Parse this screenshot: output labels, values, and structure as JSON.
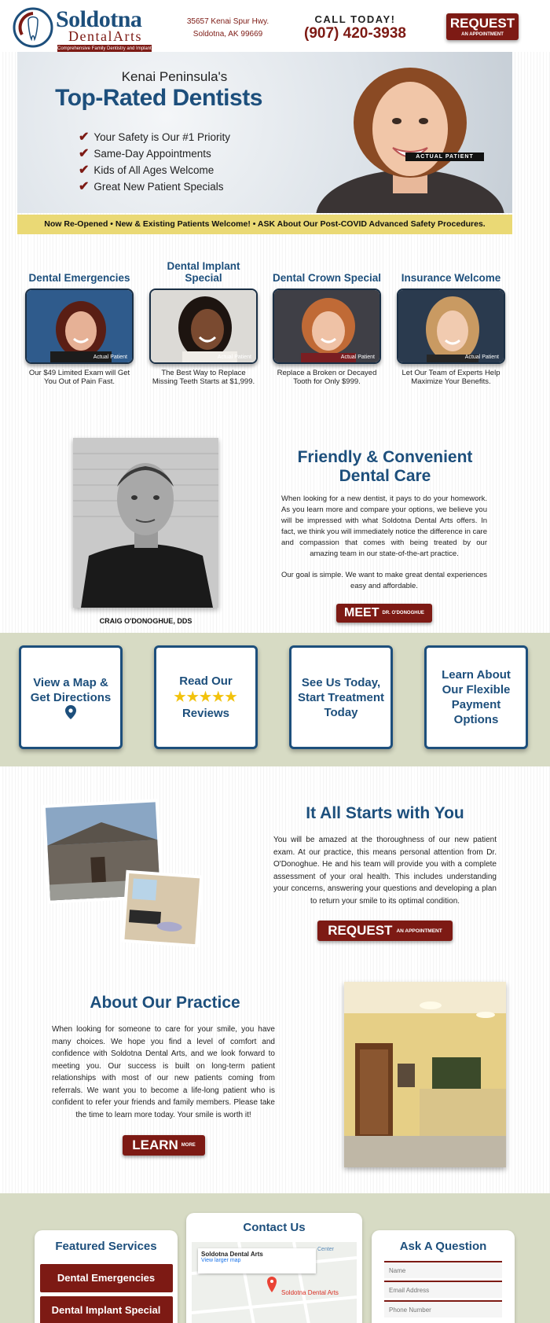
{
  "header": {
    "logo_name": "Soldotna",
    "logo_sub": "DentalArts",
    "logo_tag": "Comprehensive Family Dentistry and Implants",
    "address_line1": "35657 Kenai Spur Hwy.",
    "address_line2": "Soldotna, AK 99669",
    "call_label": "CALL TODAY!",
    "phone": "(907) 420-3938",
    "request_big": "REQUEST",
    "request_small": "AN APPOINTMENT"
  },
  "hero": {
    "subtitle": "Kenai Peninsula's",
    "title": "Top-Rated Dentists",
    "checklist": [
      "Your Safety is Our #1 Priority",
      "Same-Day Appointments",
      "Kids of All Ages Welcome",
      "Great New Patient Specials"
    ],
    "badge": "ACTUAL PATIENT",
    "banner": "Now Re-Opened  •  New & Existing Patients Welcome!  •  ASK About Our Post-COVID Advanced Safety Procedures."
  },
  "specials": [
    {
      "title": "Dental Emergencies",
      "badge": "Actual Patient",
      "desc": "Our $49 Limited Exam will Get You Out of Pain Fast."
    },
    {
      "title": "Dental Implant Special",
      "badge": "Actual Patient",
      "desc": "The Best Way to Replace Missing Teeth Starts at $1,999."
    },
    {
      "title": "Dental Crown Special",
      "badge": "Actual Patient",
      "desc": "Replace a Broken or Decayed Tooth for Only $999."
    },
    {
      "title": "Insurance Welcome",
      "badge": "Actual Patient",
      "desc": "Let Our Team of Experts Help Maximize Your Benefits."
    }
  ],
  "doctor": {
    "name": "CRAIG O'DONOGHUE, DDS",
    "title": "Friendly & Convenient Dental Care",
    "p1": "When looking for a new dentist, it pays to do your homework. As you learn more and compare your options, we believe you will be impressed with what Soldotna Dental Arts offers. In fact, we think you will immediately notice the difference in care and compassion that comes with being treated by our amazing team in our state-of-the-art practice.",
    "p2": "Our goal is simple. We want to make great dental experiences easy and affordable.",
    "meet_big": "MEET",
    "meet_small": "DR. O'DONOGHUE"
  },
  "cta": {
    "map": "View a Map & Get Directions",
    "reviews_top": "Read Our",
    "stars": "★★★★★",
    "reviews_bottom": "Reviews",
    "today": "See Us Today, Start Treatment Today",
    "payment": "Learn About Our Flexible Payment Options"
  },
  "starts": {
    "title": "It All Starts with You",
    "text": "You will be amazed at the thoroughness of our new patient exam. At our practice, this means personal attention from Dr. O'Donoghue. He and his team will provide you with a complete assessment of your oral health. This includes understanding your concerns, answering your questions and developing a plan to return your smile to its optimal condition.",
    "btn_big": "REQUEST",
    "btn_small": "AN APPOINTMENT"
  },
  "about": {
    "title": "About Our Practice",
    "text": "When looking for someone to care for your smile, you have many choices. We hope you find a level of comfort and confidence with Soldotna Dental Arts, and we look forward to meeting you. Our success is built on long-term patient relationships with most of our new patients coming from referrals. We want you to become a life-long patient who is confident to refer your friends and family members. Please take the time to learn more today. Your smile is worth it!",
    "btn_big": "LEARN",
    "btn_small": "MORE"
  },
  "footer": {
    "services_title": "Featured Services",
    "services": [
      "Dental Emergencies",
      "Dental Implant Special"
    ],
    "contact_title": "Contact Us",
    "map_name": "Soldotna Dental Arts",
    "map_link": "View larger map",
    "map_place": "Soldotna Dental Arts",
    "map_center": "Center",
    "ask_title": "Ask A Question",
    "fields": [
      "Name",
      "Email Address",
      "Phone Number"
    ]
  },
  "colors": {
    "navy": "#1d4f7c",
    "maroon": "#7d1a14",
    "banner_yellow": "#ead975",
    "band_green": "#d7dbc4",
    "star_gold": "#f2c20c"
  }
}
